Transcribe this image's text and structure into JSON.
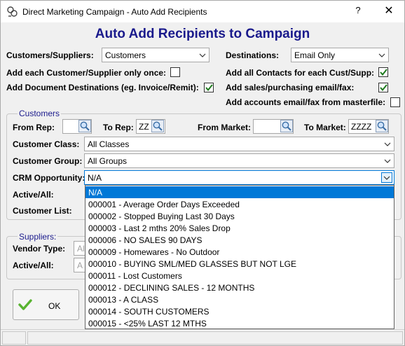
{
  "window": {
    "title": "Direct Marketing Campaign - Auto Add Recipients",
    "help": "?",
    "close": "✕"
  },
  "heading": "Auto Add Recipients to Campaign",
  "top": {
    "customers_suppliers_label": "Customers/Suppliers:",
    "customers_suppliers_value": "Customers",
    "destinations_label": "Destinations:",
    "destinations_value": "Email Only",
    "add_once_label": "Add each Customer/Supplier only once:",
    "add_once_checked": false,
    "add_doc_dest_label": "Add Document Destinations (eg. Invoice/Remit):",
    "add_doc_dest_checked": true,
    "add_all_contacts_label": "Add all Contacts for each Cust/Supp:",
    "add_all_contacts_checked": true,
    "add_sales_email_label": "Add sales/purchasing email/fax:",
    "add_sales_email_checked": true,
    "add_accounts_email_label": "Add accounts email/fax from masterfile:",
    "add_accounts_email_checked": false
  },
  "customers": {
    "legend": "Customers",
    "from_rep_label": "From Rep:",
    "from_rep_value": "",
    "to_rep_label": "To Rep:",
    "to_rep_value": "ZZ",
    "from_market_label": "From Market:",
    "from_market_value": "",
    "to_market_label": "To Market:",
    "to_market_value": "ZZZZ",
    "class_label": "Customer Class:",
    "class_value": "All Classes",
    "group_label": "Customer Group:",
    "group_value": "All Groups",
    "crm_label": "CRM Opportunity:",
    "crm_value": "N/A",
    "active_label": "Active/All:",
    "list_label": "Customer List:"
  },
  "suppliers": {
    "legend": "Suppliers:",
    "vendor_type_label": "Vendor Type:",
    "vendor_type_value": "All",
    "active_label": "Active/All:",
    "active_value": "A"
  },
  "ok_button": {
    "label": "OK"
  },
  "crm_dropdown": {
    "selected_index": 0,
    "options": [
      "N/A",
      "000001 - Average Order Days Exceeded",
      "000002 - Stopped Buying Last 30 Days",
      "000003 - Last 2 mths 20% Sales Drop",
      "000006 - NO SALES 90 DAYS",
      "000009 - Homewares - No Outdoor",
      "000010 - BUYING SML/MED GLASSES BUT NOT LGE",
      "000011 - Lost Customers",
      "000012 - DECLINING SALES - 12 MONTHS",
      "000013 - A CLASS",
      "000014 - SOUTH CUSTOMERS",
      "000015 - <25% LAST 12 MTHS"
    ]
  },
  "colors": {
    "heading": "#1a1a8c",
    "selection": "#0078d7",
    "check": "#1e7a1e"
  }
}
